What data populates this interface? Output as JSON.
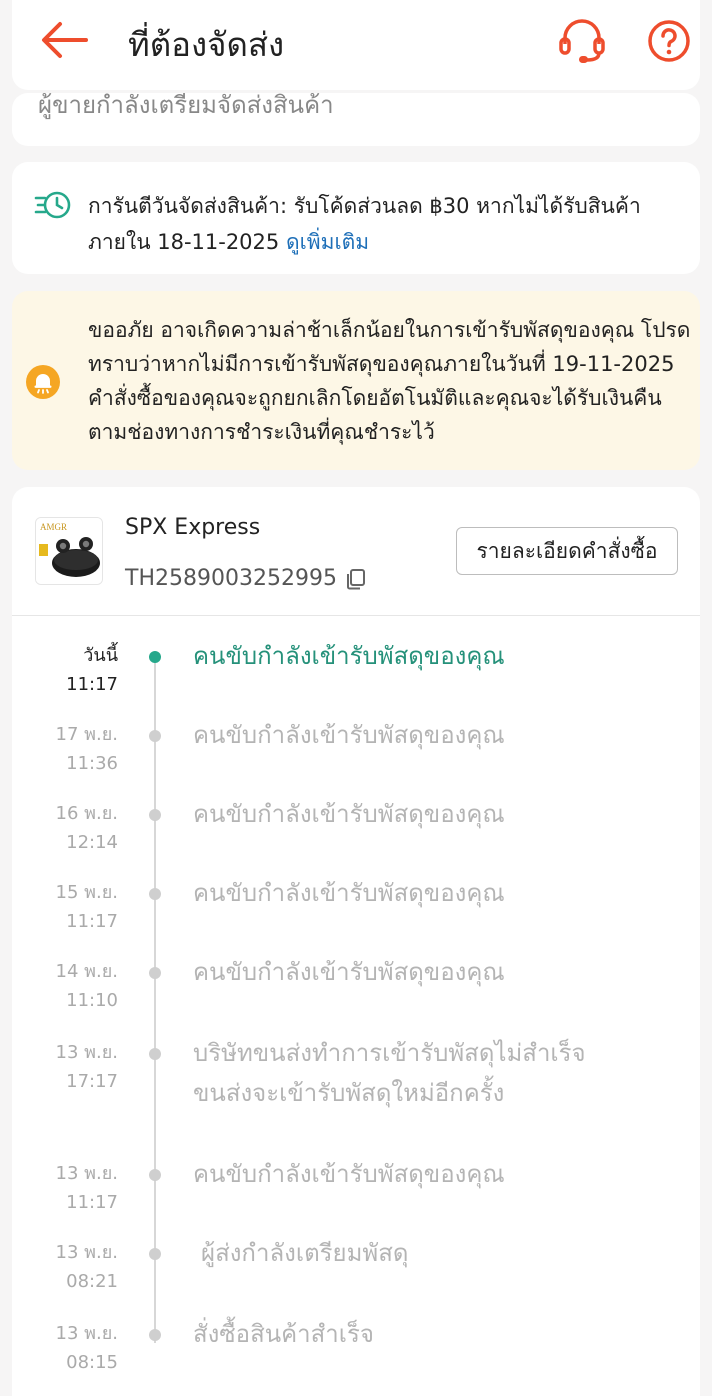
{
  "header": {
    "title": "ที่ต้องจัดส่ง"
  },
  "partial_banner": {
    "text": "ผู้ขายกำลังเตรียมจัดส่งสินค้า"
  },
  "guarantee": {
    "text": "การันตีวันจัดส่งสินค้า: รับโค้ดส่วนลด ฿30 หากไม่ได้รับสินค้าภายใน 18-11-2025 ",
    "link": "ดูเพิ่มเติม"
  },
  "notice": {
    "text": "ขออภัย อาจเกิดความล่าช้าเล็กน้อยในการเข้ารับพัสดุของคุณ โปรดทราบว่าหากไม่มีการเข้ารับพัสดุของคุณภายในวันที่ 19-11-2025 คำสั่งซื้อของคุณจะถูกยกเลิกโดยอัตโนมัติและคุณจะได้รับเงินคืนตามช่องทางการชำระเงินที่คุณชำระไว้"
  },
  "shipment": {
    "carrier": "SPX Express",
    "tracking_no": "TH2589003252995",
    "details_button": "รายละเอียดคำสั่งซื้อ",
    "product_thumb_text": "AMGR"
  },
  "timeline": [
    {
      "date": "วันนี้",
      "time": "11:17",
      "status": "คนขับกำลังเข้ารับพัสดุของคุณ",
      "current": true
    },
    {
      "date": "17 พ.ย.",
      "time": "11:36",
      "status": "คนขับกำลังเข้ารับพัสดุของคุณ",
      "current": false
    },
    {
      "date": "16 พ.ย.",
      "time": "12:14",
      "status": "คนขับกำลังเข้ารับพัสดุของคุณ",
      "current": false
    },
    {
      "date": "15 พ.ย.",
      "time": "11:17",
      "status": "คนขับกำลังเข้ารับพัสดุของคุณ",
      "current": false
    },
    {
      "date": "14 พ.ย.",
      "time": "11:10",
      "status": "คนขับกำลังเข้ารับพัสดุของคุณ",
      "current": false
    },
    {
      "date": "13 พ.ย.",
      "time": "17:17",
      "status": "บริษัทขนส่งทำการเข้ารับพัสดุไม่สำเร็จ ขนส่งจะเข้ารับพัสดุใหม่อีกครั้ง",
      "current": false
    },
    {
      "date": "13 พ.ย.",
      "time": "11:17",
      "status": "คนขับกำลังเข้ารับพัสดุของคุณ",
      "current": false
    },
    {
      "date": "13 พ.ย.",
      "time": "08:21",
      "status": "ผู้ส่งกำลังเตรียมพัสดุ",
      "current": false
    },
    {
      "date": "13 พ.ย.",
      "time": "08:15",
      "status": "สั่งซื้อสินค้าสำเร็จ",
      "current": false
    }
  ],
  "colors": {
    "brand_orange": "#ee4d2d",
    "active_green": "#25917a",
    "link_blue": "#1e6fb8",
    "notice_bg": "#fdf7e6",
    "bell_orange": "#f5a623"
  }
}
